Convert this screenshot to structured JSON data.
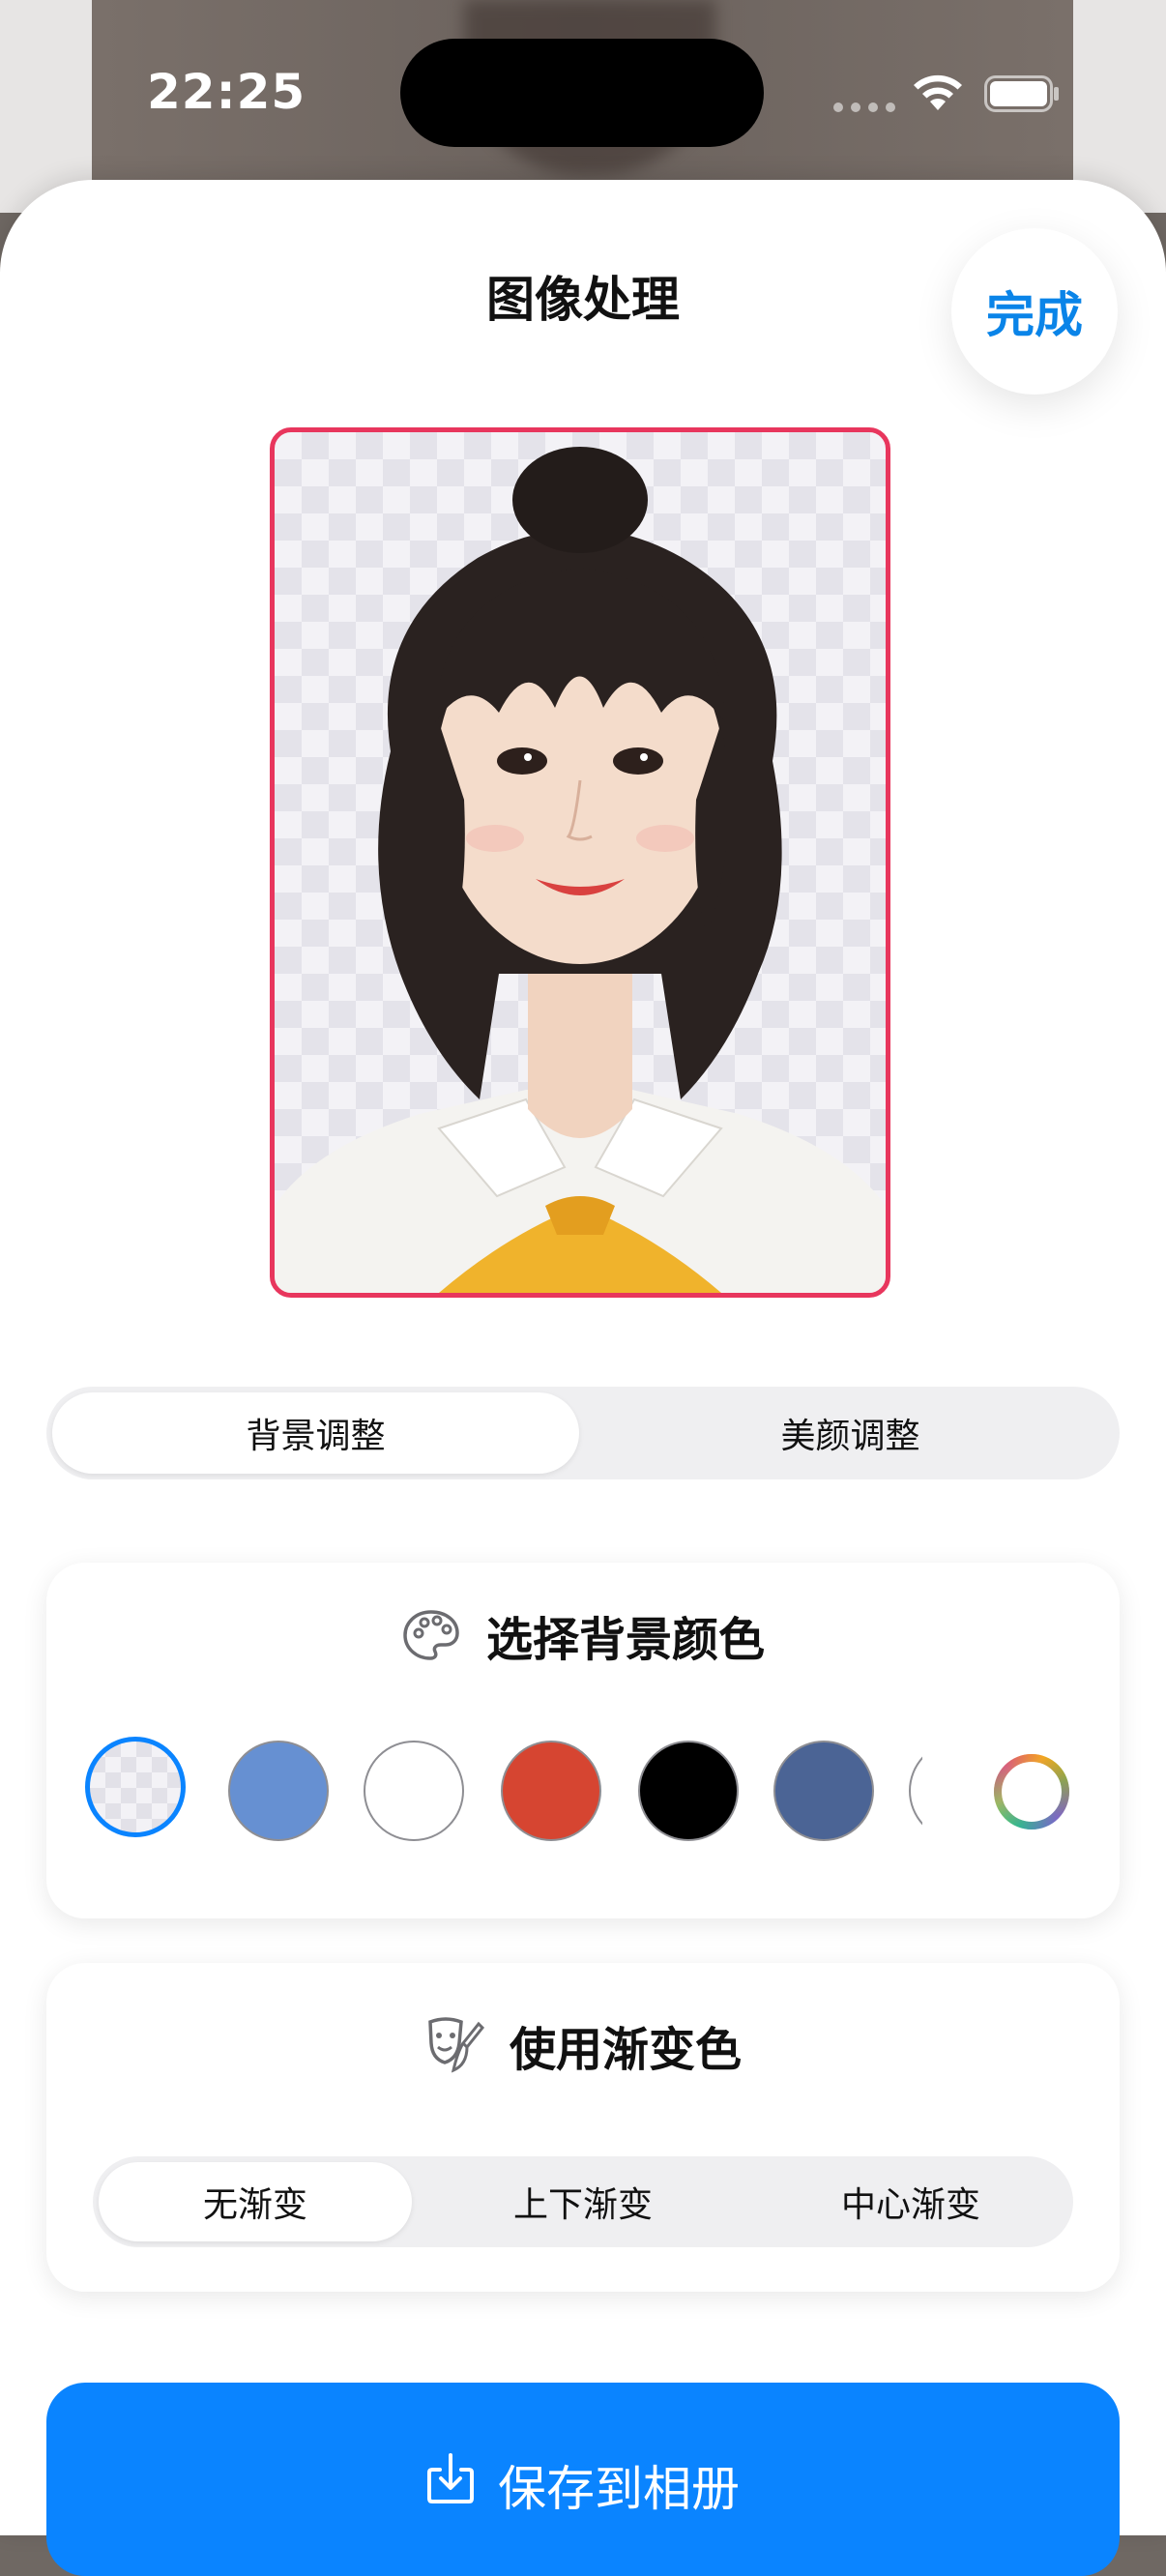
{
  "status_bar": {
    "time": "22:25"
  },
  "header": {
    "title": "图像处理",
    "done_label": "完成"
  },
  "tabs": [
    {
      "label": "背景调整",
      "active": true
    },
    {
      "label": "美颜调整",
      "active": false
    }
  ],
  "background_color_card": {
    "title": "选择背景颜色",
    "icon": "palette-icon",
    "swatches": [
      {
        "name": "transparent",
        "color": "transparent",
        "selected": true
      },
      {
        "name": "light-blue",
        "color": "#6690d2",
        "selected": false
      },
      {
        "name": "white",
        "color": "#ffffff",
        "selected": false
      },
      {
        "name": "red",
        "color": "#d64531",
        "selected": false
      },
      {
        "name": "black",
        "color": "#000000",
        "selected": false
      },
      {
        "name": "dark-blue",
        "color": "#4b6495",
        "selected": false
      }
    ],
    "custom_color_icon": "color-wheel-icon"
  },
  "gradient_card": {
    "title": "使用渐变色",
    "icon": "theater-masks-icon",
    "options": [
      {
        "label": "无渐变",
        "active": true
      },
      {
        "label": "上下渐变",
        "active": false
      },
      {
        "label": "中心渐变",
        "active": false
      }
    ]
  },
  "save_button": {
    "label": "保存到相册",
    "icon": "download-icon"
  },
  "colors": {
    "accent": "#0a84ff",
    "frame_border": "#e8365d",
    "done_text": "#0a84e8"
  }
}
